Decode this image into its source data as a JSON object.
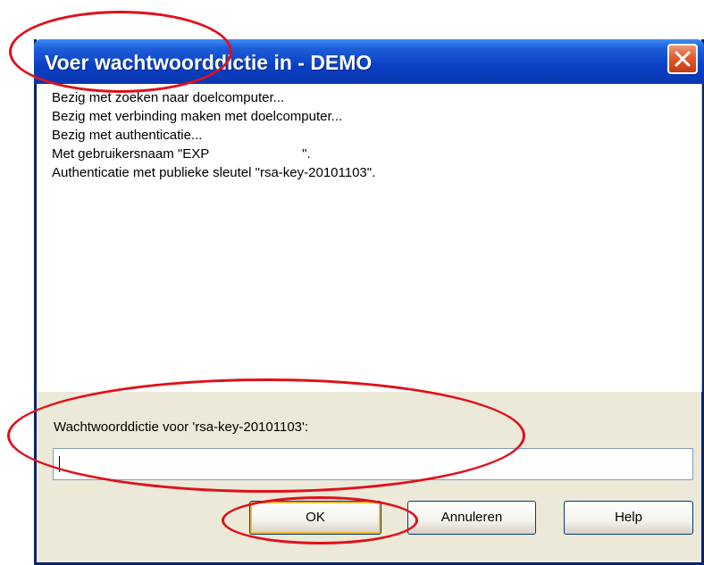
{
  "dialog": {
    "title": "Voer wachtwoorddictie in - DEMO",
    "log_lines": [
      "Bezig met zoeken naar doelcomputer...",
      "Bezig met verbinding maken met doelcomputer...",
      "Bezig met authenticatie...",
      "Met gebruikersnaam \"EXP                         \".",
      "Authenticatie met publieke sleutel \"rsa-key-20101103\"."
    ],
    "prompt_label": "Wachtwoorddictie voor 'rsa-key-20101103':",
    "passphrase_value": "",
    "buttons": {
      "ok": "OK",
      "cancel": "Annuleren",
      "help": "Help"
    }
  },
  "colors": {
    "titlebar": "#0a3fc4",
    "dialog_bg": "#ece9d8",
    "close_button": "#e25a2c",
    "annotation": "#e0101a"
  },
  "icons": {
    "close": "close-icon"
  }
}
